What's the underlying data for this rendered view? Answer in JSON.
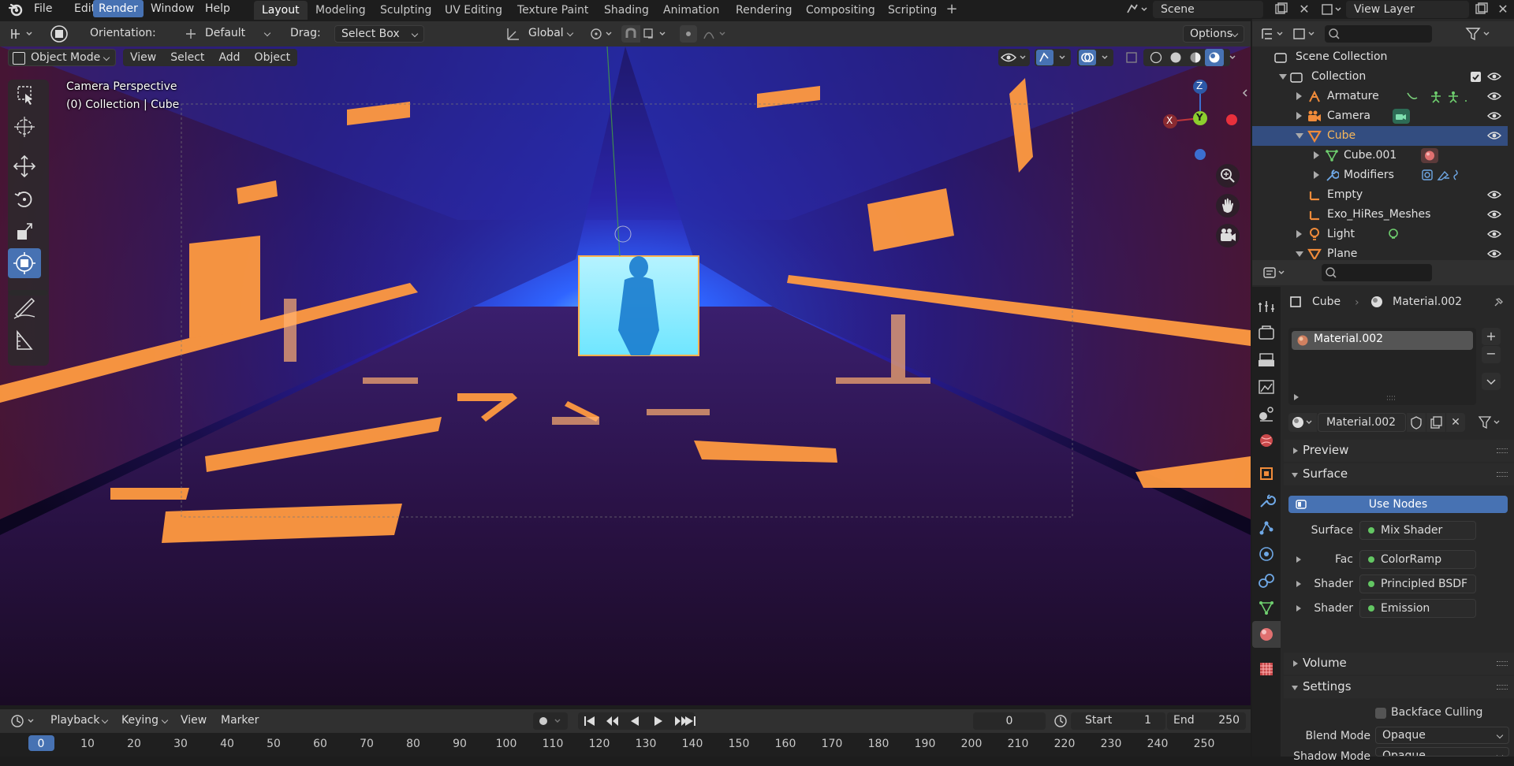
{
  "menu": {
    "file": "File",
    "edit": "Edit",
    "render": "Render",
    "window": "Window",
    "help": "Help"
  },
  "workspaces": [
    "Layout",
    "Modeling",
    "Sculpting",
    "UV Editing",
    "Texture Paint",
    "Shading",
    "Animation",
    "Rendering",
    "Compositing",
    "Scripting"
  ],
  "scene": {
    "name": "Scene",
    "view_layer": "View Layer"
  },
  "tool_header": {
    "orientation_label": "Orientation:",
    "orientation_value": "Default",
    "drag_label": "Drag:",
    "drag_value": "Select Box",
    "transform": "Global",
    "options": "Options"
  },
  "viewport_header": {
    "mode": "Object Mode",
    "view": "View",
    "select": "Select",
    "add": "Add",
    "object": "Object"
  },
  "viewport": {
    "overlay_line1": "Camera Perspective",
    "overlay_line2": "(0) Collection | Cube",
    "gizmo": {
      "z": "Z",
      "y": "Y",
      "x": "X"
    }
  },
  "outliner": {
    "root": "Scene Collection",
    "collection": "Collection",
    "items": [
      {
        "name": "Armature",
        "icon": "armature-icon"
      },
      {
        "name": "Camera",
        "icon": "camera-icon"
      },
      {
        "name": "Cube",
        "icon": "mesh-icon",
        "selected": true
      },
      {
        "name": "Cube.001",
        "icon": "mesh-data-icon"
      },
      {
        "name": "Modifiers",
        "icon": "wrench-icon"
      },
      {
        "name": "Empty",
        "icon": "empty-icon"
      },
      {
        "name": "Exo_HiRes_Meshes",
        "icon": "empty-icon"
      },
      {
        "name": "Light",
        "icon": "light-icon"
      },
      {
        "name": "Plane",
        "icon": "mesh-icon"
      }
    ]
  },
  "properties": {
    "breadcrumb_object": "Cube",
    "breadcrumb_material": "Material.002",
    "slot_name": "Material.002",
    "material_name": "Material.002",
    "sections": {
      "preview": "Preview",
      "surface": "Surface",
      "volume": "Volume",
      "settings": "Settings"
    },
    "use_nodes": "Use Nodes",
    "surface_rows": [
      {
        "label": "Surface",
        "value": "Mix Shader"
      },
      {
        "label": "Fac",
        "value": "ColorRamp"
      },
      {
        "label": "Shader",
        "value": "Principled BSDF"
      },
      {
        "label": "Shader",
        "value": "Emission"
      }
    ],
    "backface_culling": "Backface Culling",
    "blend_mode_label": "Blend Mode",
    "blend_mode_value": "Opaque",
    "shadow_mode_label": "Shadow Mode",
    "shadow_mode_value": "Opaque"
  },
  "timeline": {
    "playback": "Playback",
    "keying": "Keying",
    "view": "View",
    "marker": "Marker",
    "current_frame": "0",
    "start_label": "Start",
    "start_value": "1",
    "end_label": "End",
    "end_value": "250",
    "ruler": [
      "0",
      "10",
      "20",
      "30",
      "40",
      "50",
      "60",
      "70",
      "80",
      "90",
      "100",
      "110",
      "120",
      "130",
      "140",
      "150",
      "160",
      "170",
      "180",
      "190",
      "200",
      "210",
      "220",
      "230",
      "240",
      "250"
    ]
  },
  "colors": {
    "accent": "#4772b3",
    "selection": "#334d80",
    "header": "#303030",
    "background": "#1d1d1d",
    "socket": "#63c763"
  }
}
